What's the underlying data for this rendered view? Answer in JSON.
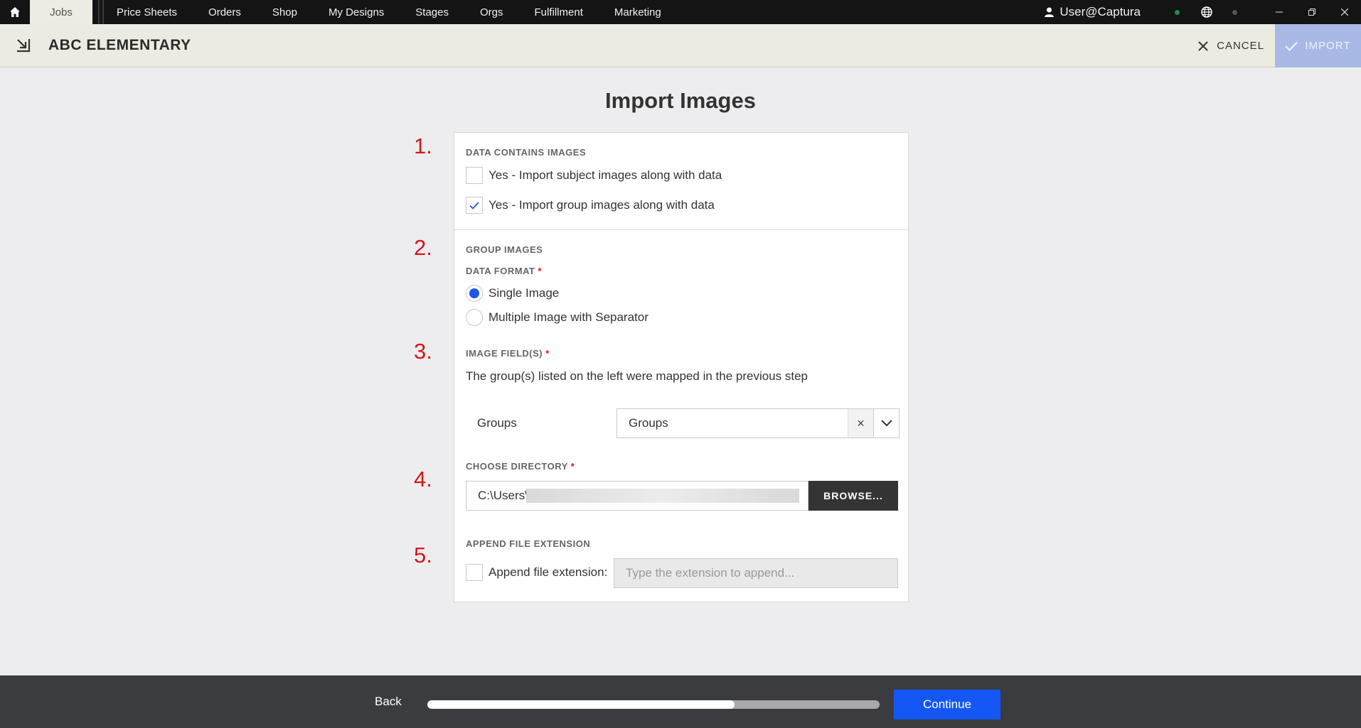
{
  "topbar": {
    "active_tab": "Jobs",
    "nav": [
      "Price Sheets",
      "Orders",
      "Shop",
      "My Designs",
      "Stages",
      "Orgs",
      "Fulfillment",
      "Marketing"
    ],
    "user": "User@Captura",
    "icons": [
      "home-icon",
      "user-icon",
      "globe-icon",
      "minimize-icon",
      "restore-icon",
      "close-icon"
    ]
  },
  "header": {
    "title": "ABC ELEMENTARY",
    "cancel_label": "CANCEL",
    "import_label": "IMPORT",
    "import_bg": "#a9b9e6"
  },
  "main": {
    "title": "Import Images",
    "steps": [
      "1.",
      "2.",
      "3.",
      "4.",
      "5."
    ],
    "data_contains_images": {
      "label": "DATA CONTAINS IMAGES",
      "options": [
        {
          "label": "Yes - Import subject images along with data",
          "checked": false
        },
        {
          "label": "Yes - Import group images along with data",
          "checked": true
        }
      ]
    },
    "group_images": {
      "label": "GROUP IMAGES",
      "format_label": "DATA FORMAT",
      "required_mark": "*",
      "formats": [
        {
          "label": "Single Image",
          "selected": true
        },
        {
          "label": "Multiple Image with Separator",
          "selected": false
        }
      ]
    },
    "image_fields": {
      "label": "IMAGE FIELD(S)",
      "description": "The group(s) listed on the left were mapped in the previous step",
      "row_label": "Groups",
      "select_value": "Groups",
      "clear_symbol": "×"
    },
    "directory": {
      "label": "CHOOSE DIRECTORY",
      "value": "C:\\Users\\",
      "browse_label": "BROWSE..."
    },
    "append_extension": {
      "label": "APPEND FILE EXTENSION",
      "checkbox_label": "Append file extension:",
      "checked": false,
      "placeholder": "Type the extension to append..."
    }
  },
  "footer": {
    "back_label": "Back",
    "continue_label": "Continue",
    "progress_fraction": 0.68,
    "accent": "#1457f4"
  }
}
